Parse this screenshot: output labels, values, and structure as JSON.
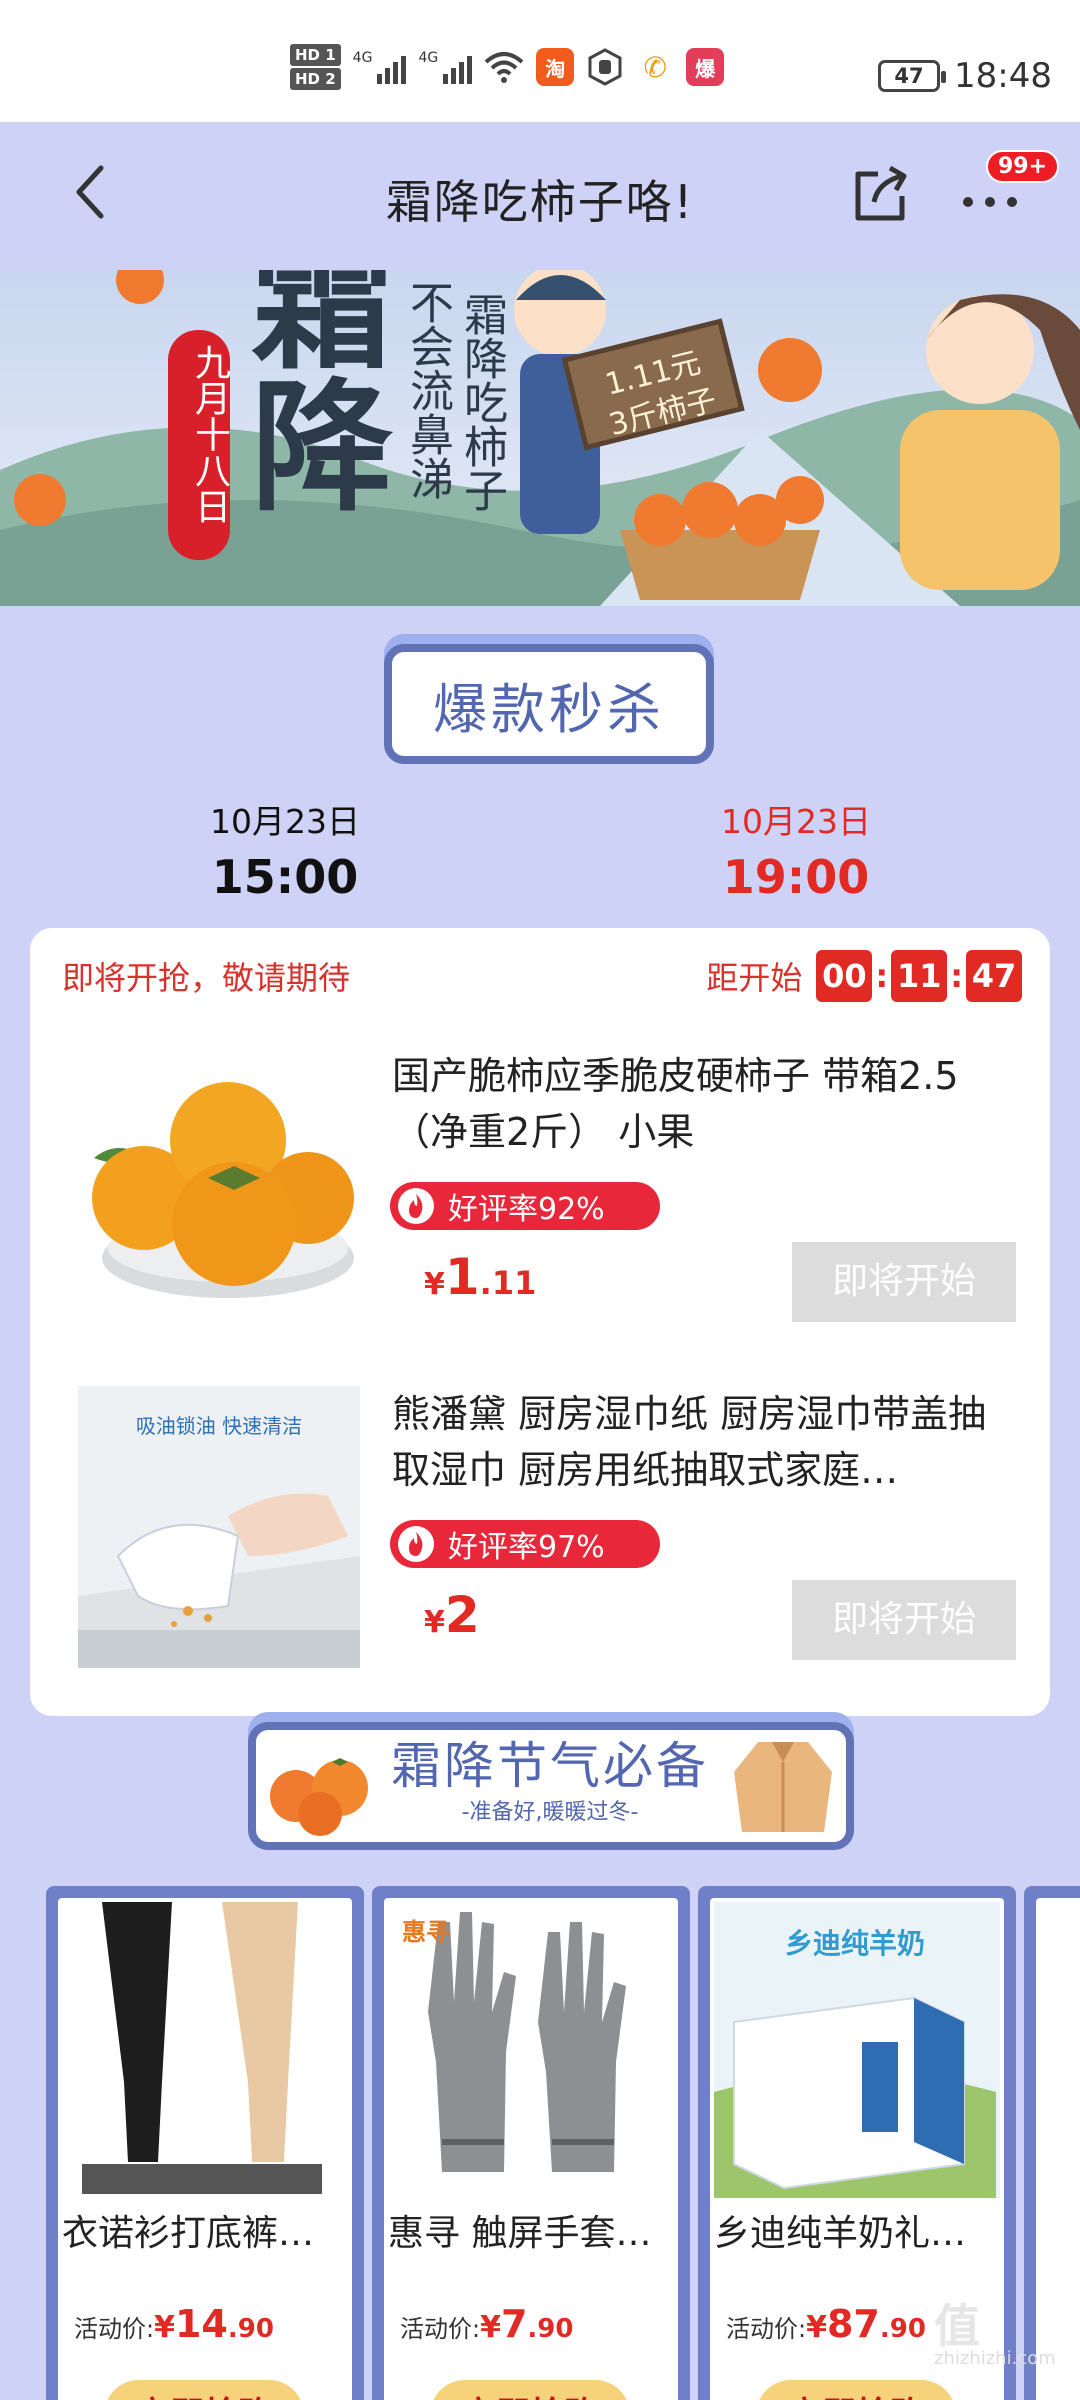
{
  "status": {
    "hd1": "HD 1",
    "hd2": "HD 2",
    "net": "4G",
    "battery": "47",
    "time": "18:48",
    "app_icon_1": "淘",
    "app_icon_3": "爆"
  },
  "nav": {
    "title": "霜降吃柿子咯!",
    "badge": "99+"
  },
  "banner": {
    "big_text": "霜降",
    "date_tag": "九月十八日",
    "line1": "不会流鼻涕",
    "line2": "霜降吃柿子",
    "sign": "1.11元\n3斤柿子"
  },
  "flash": {
    "heading": "爆款秒杀",
    "slots": [
      {
        "date": "10月23日",
        "time": "15:00"
      },
      {
        "date": "10月23日",
        "time": "19:00"
      }
    ],
    "notice": "即将开抢，敬请期待",
    "countdown_label": "距开始",
    "countdown": {
      "h": "00",
      "m": "11",
      "s": "47"
    },
    "items": [
      {
        "name": "国产脆柿应季脆皮硬柿子 带箱2.5（净重2斤） 小果",
        "rating": "好评率92%",
        "currency": "¥",
        "price_int": "1",
        "price_frac": ".11",
        "button": "即将开始"
      },
      {
        "name": "熊潘黛 厨房湿巾纸 厨房湿巾带盖抽取湿巾 厨房用纸抽取式家庭…",
        "rating": "好评率97%",
        "currency": "¥",
        "price_int": "2",
        "price_frac": "",
        "button": "即将开始",
        "image_text": "吸油锁油 快速清洁"
      }
    ]
  },
  "season": {
    "heading": "霜降节气必备",
    "subheading": "-准备好,暖暖过冬-",
    "products": [
      {
        "name": "衣诺衫打底裤…",
        "price_label": "活动价:",
        "currency": "¥",
        "price_int": "14",
        "price_frac": ".90",
        "button": "立即抢购"
      },
      {
        "name": "惠寻 触屏手套…",
        "price_label": "活动价:",
        "currency": "¥",
        "price_int": "7",
        "price_frac": ".90",
        "button": "立即抢购",
        "brand": "惠寻"
      },
      {
        "name": "乡迪纯羊奶礼…",
        "price_label": "活动价:",
        "currency": "¥",
        "price_int": "87",
        "price_frac": ".90",
        "button": "立即抢购",
        "brand": "乡迪纯羊奶"
      }
    ]
  },
  "watermark": {
    "logo": "值",
    "site": "zhizhizhi.com"
  },
  "colors": {
    "accent": "#e12a24",
    "page_bg": "#cdd2f6",
    "section_border": "#6173b6"
  }
}
